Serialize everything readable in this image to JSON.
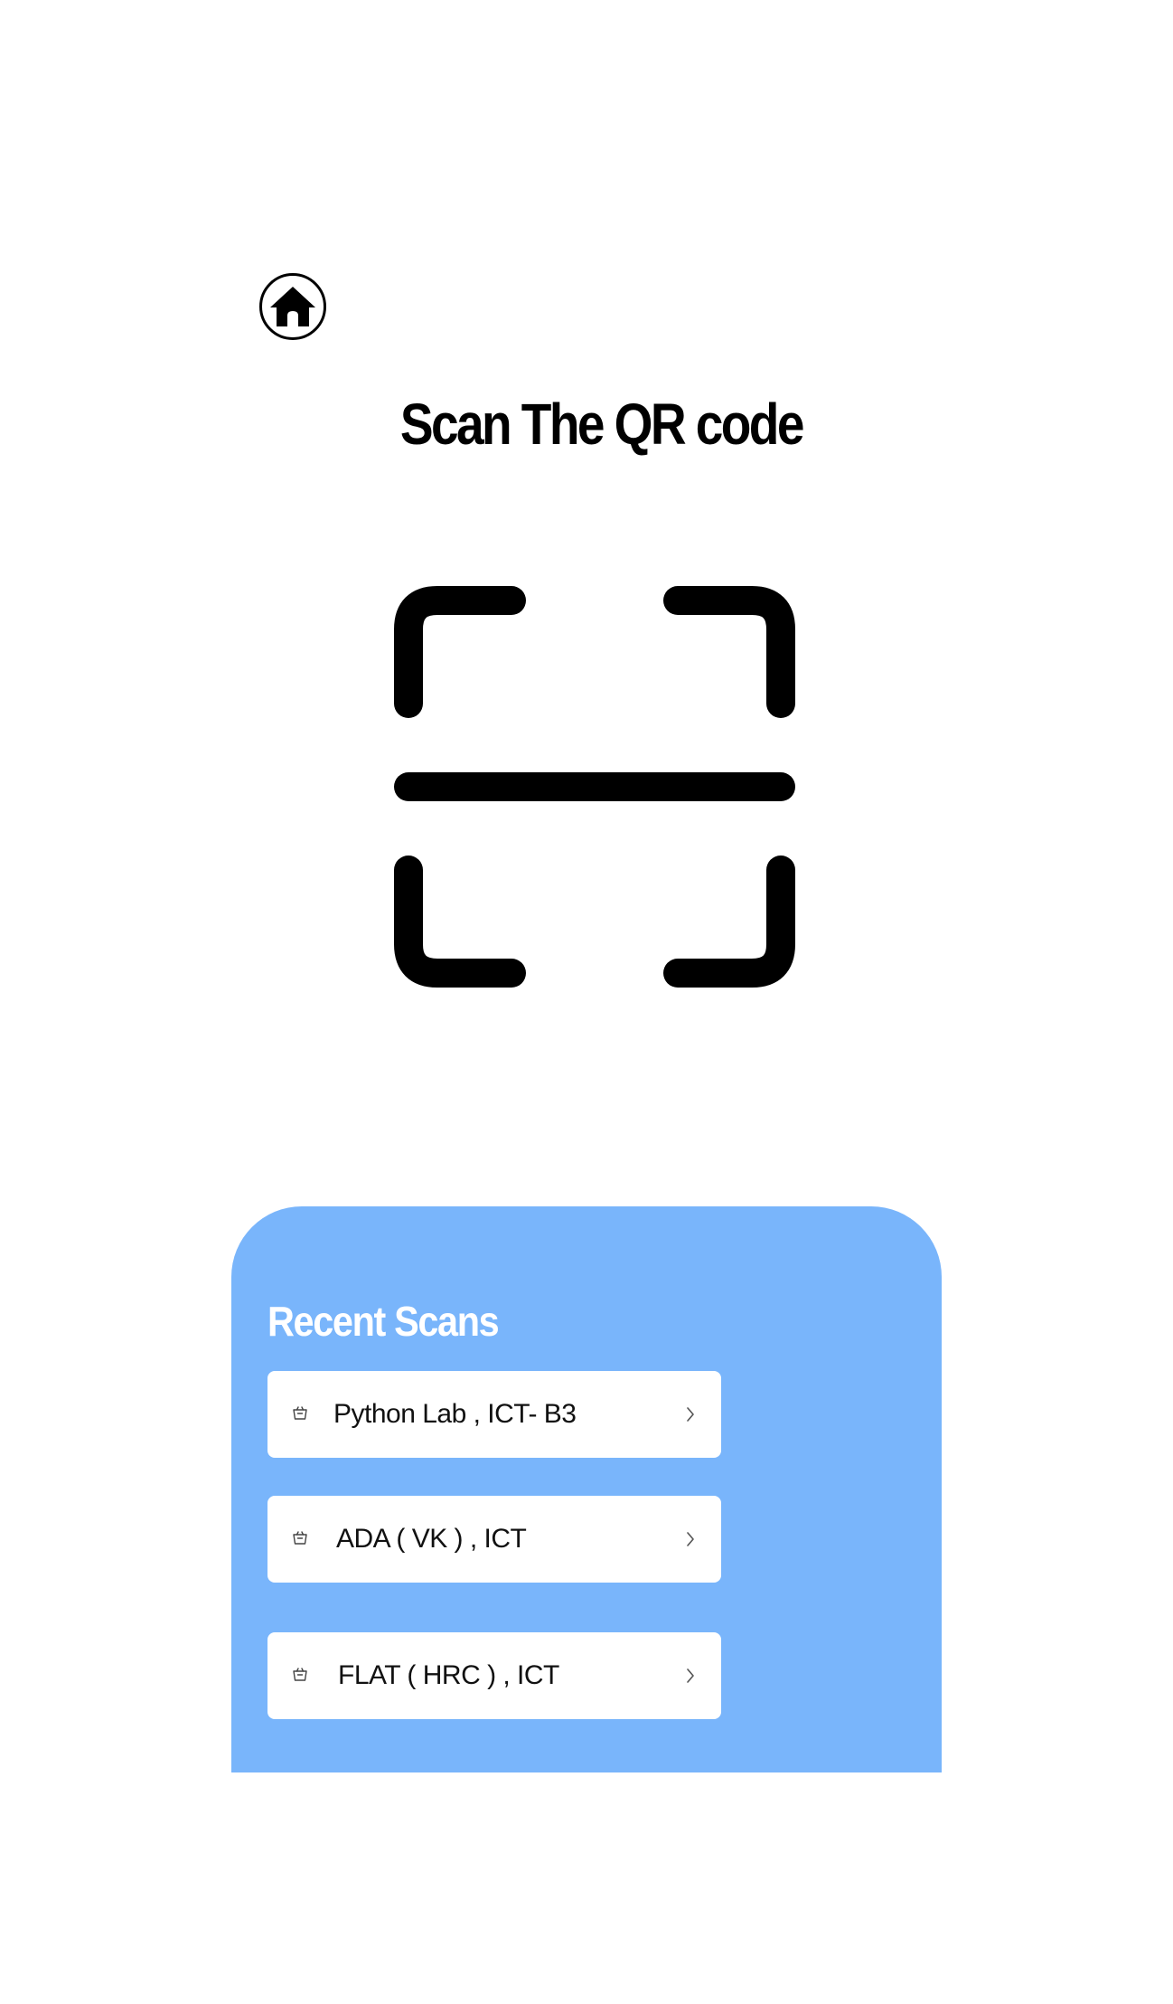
{
  "header": {
    "title": "Scan The QR code"
  },
  "recent": {
    "title": "Recent Scans",
    "items": [
      {
        "label": "Python Lab , ICT-  B3"
      },
      {
        "label": "ADA ( VK ) , ICT"
      },
      {
        "label": "FLAT ( HRC ) , ICT"
      }
    ]
  },
  "icons": {
    "home": "home-icon",
    "scan": "qr-scan-icon",
    "item": "basket-icon",
    "chevron": "chevron-right-icon"
  },
  "colors": {
    "panel": "#79b5fb",
    "text": "#000000",
    "card": "#ffffff"
  }
}
